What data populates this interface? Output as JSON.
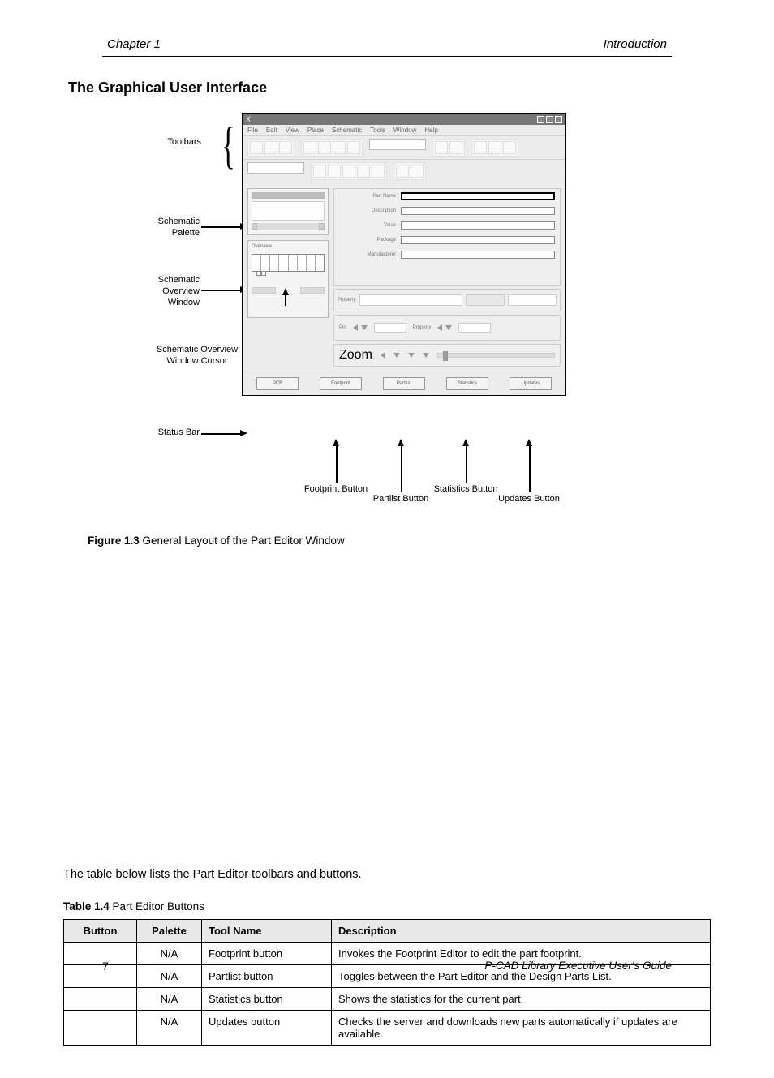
{
  "running_head": {
    "left": "Chapter 1",
    "right": "Introduction"
  },
  "section_title": "The Graphical User Interface",
  "figure": {
    "callouts": {
      "toolbars": "Toolbars",
      "sch_palette": "Schematic\nPalette",
      "overview": "Schematic\nOverview\nWindow",
      "ov_cursor": "Schematic Overview\nWindow Cursor",
      "status": "Status Bar",
      "footprint_btn": "Footprint Button",
      "partlist_btn": "Partlist Button",
      "stats_btn": "Statistics Button",
      "updates_btn": "Updates Button"
    },
    "window": {
      "title": "X",
      "menu": [
        "File",
        "Edit",
        "View",
        "Place",
        "Schematic",
        "Tools",
        "Window",
        "Help"
      ],
      "form_labels": {
        "name": "Part Name",
        "desc": "Description",
        "value": "Value",
        "pkg": "Package",
        "mfg": "Manufacturer"
      },
      "prop_label": "Property",
      "nav": {
        "pin": "Pin",
        "property": "Property",
        "zoom": "Zoom"
      },
      "buttons": [
        "PCB",
        "Footprint",
        "Partlist",
        "Statistics",
        "Updates"
      ]
    },
    "caption_label": "Figure 1.3",
    "caption_text": "  General Layout of the Part Editor Window"
  },
  "table_intro": "The table below lists the Part Editor toolbars and buttons.",
  "table": {
    "title_label": "Table 1.4",
    "title_text": "   Part Editor Buttons",
    "headers": [
      "Button",
      "Palette",
      "Tool Name",
      "Description"
    ],
    "rows": [
      {
        "button": "",
        "palette": "N/A",
        "tool": "Footprint button",
        "desc": "Invokes the Footprint Editor to edit the part footprint."
      },
      {
        "button": "",
        "palette": "N/A",
        "tool": "Partlist button",
        "desc": "Toggles between the Part Editor and the Design Parts List."
      },
      {
        "button": "",
        "palette": "N/A",
        "tool": "Statistics button",
        "desc": "Shows the statistics for the current part."
      },
      {
        "button": "",
        "palette": "N/A",
        "tool": "Updates button",
        "desc": "Checks the server and downloads new parts automatically if updates are available."
      }
    ]
  },
  "footer": {
    "page": "7",
    "doc": "P-CAD Library Executive User's Guide"
  }
}
